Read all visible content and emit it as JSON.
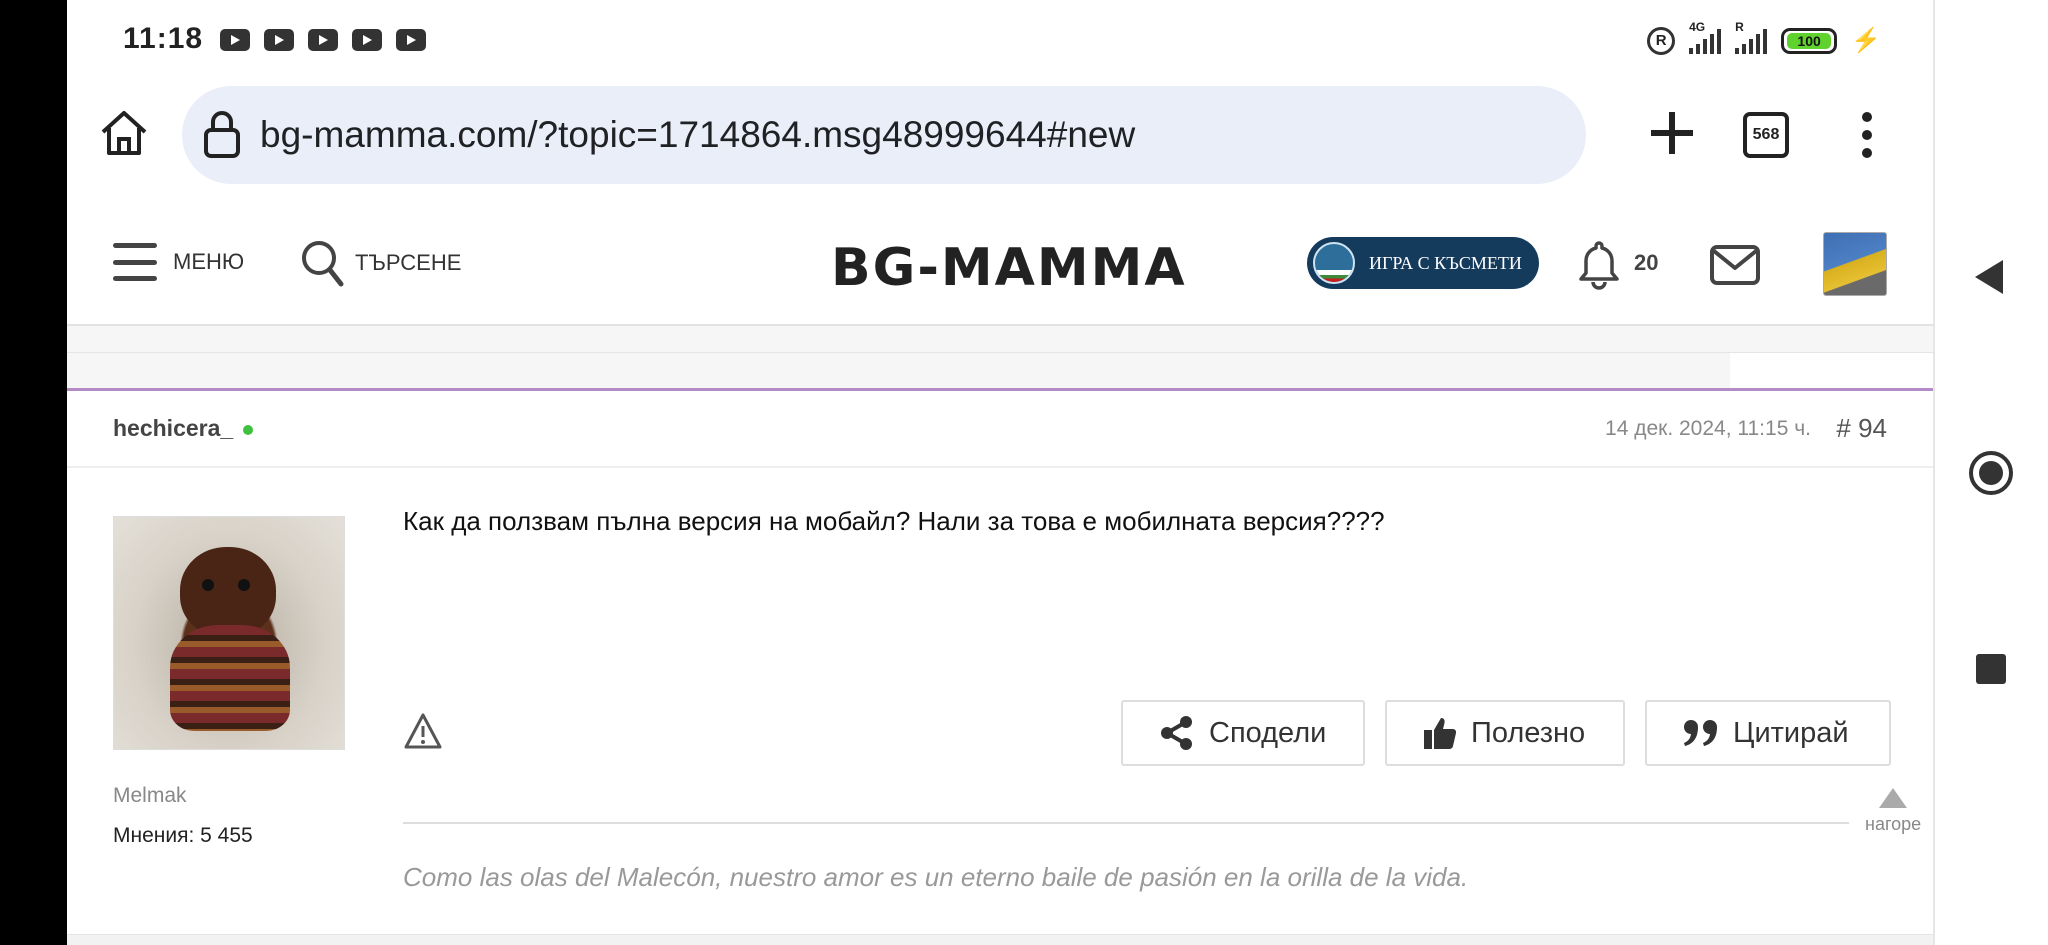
{
  "status_bar": {
    "time": "11:18",
    "network_label_1": "4G",
    "network_label_2": "R",
    "battery": "100"
  },
  "browser": {
    "url": "bg-mamma.com/?topic=1714864.msg48999644#new",
    "tab_count": "568"
  },
  "site_header": {
    "menu_label": "МЕНЮ",
    "search_label": "ТЪРСЕНЕ",
    "logo_text": "BG-MAMMA",
    "game_button_label": "ИГРА С КЪСМЕТИ",
    "notifications_count": "20"
  },
  "post": {
    "author": "hechicera_",
    "date": "14 дек. 2024, 11:15 ч.",
    "number": "# 94",
    "text": "Как да ползвам пълна версия на мобайл? Нали за това е мобилната версия????",
    "user_title": "Melmak",
    "posts_count": "Мнения: 5 455",
    "actions": {
      "share": "Сподели",
      "useful": "Полезно",
      "quote": "Цитирай"
    },
    "to_top": "нагоре",
    "signature": "Como las olas del Malecón, nuestro amor es un eterno baile de pasión en la orilla de la vida."
  },
  "colors": {
    "accent_line": "#b48ac7",
    "game_button": "#153b5c",
    "online_dot": "#3ec13e",
    "url_bar": "#e9eef8"
  }
}
